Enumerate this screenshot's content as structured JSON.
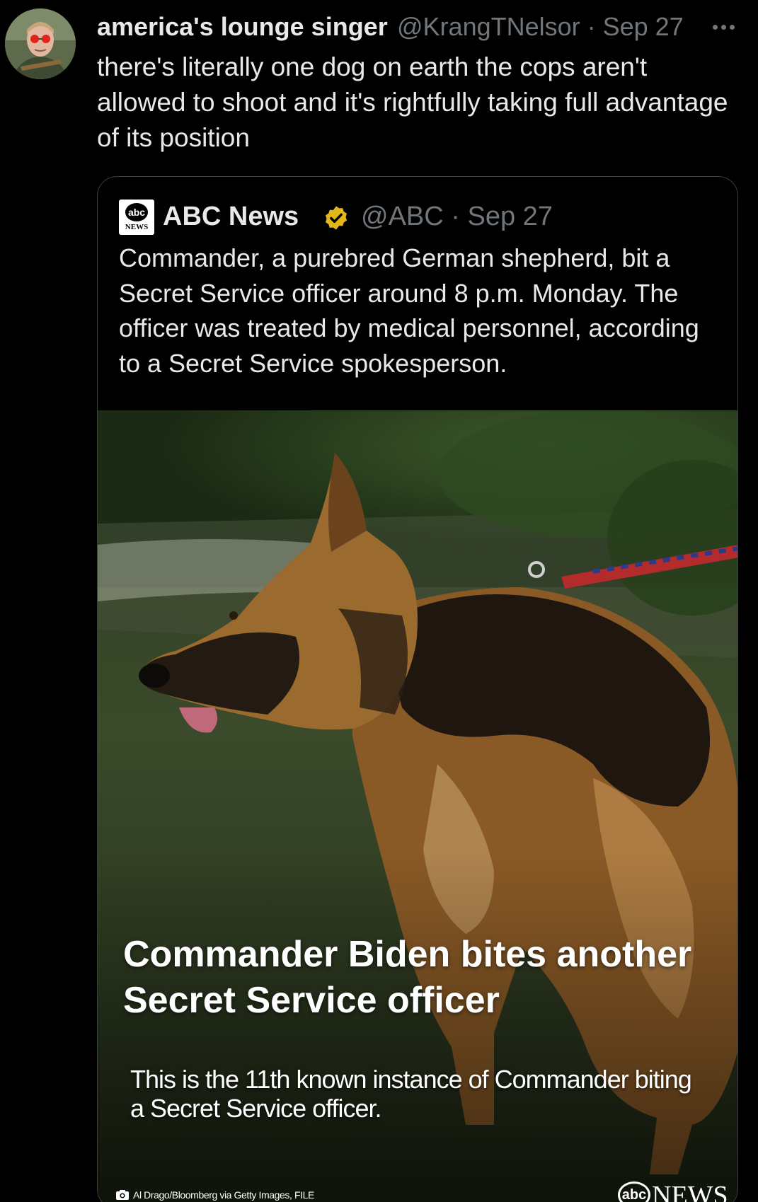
{
  "tweet": {
    "display_name": "america's lounge singer",
    "handle_date": "@KrangTNelsor · Sep 27",
    "text": "there's literally one dog on earth the cops aren't allowed to shoot and it's rightfully taking full advantage of its position",
    "icons": {
      "more": "more-icon",
      "avatar": "avatar"
    }
  },
  "quote": {
    "logo_top": "abc",
    "logo_bottom": "NEWS",
    "name": "ABC News",
    "handle_date": "@ABC · Sep 27",
    "verified_color": "#e2b719",
    "text": "Commander, a purebred German shepherd, bit a Secret Service officer around 8 p.m. Monday. The officer was treated by medical personnel, according to a Secret Service spokesperson.",
    "image": {
      "headline": "Commander Biden bites another Secret Service officer",
      "subhead": "This is the 11th known instance of Commander biting a Secret Service officer.",
      "credit": "Al Drago/Bloomberg via Getty Images, FILE",
      "brand_abc": "abc",
      "brand_news": "NEWS"
    }
  }
}
